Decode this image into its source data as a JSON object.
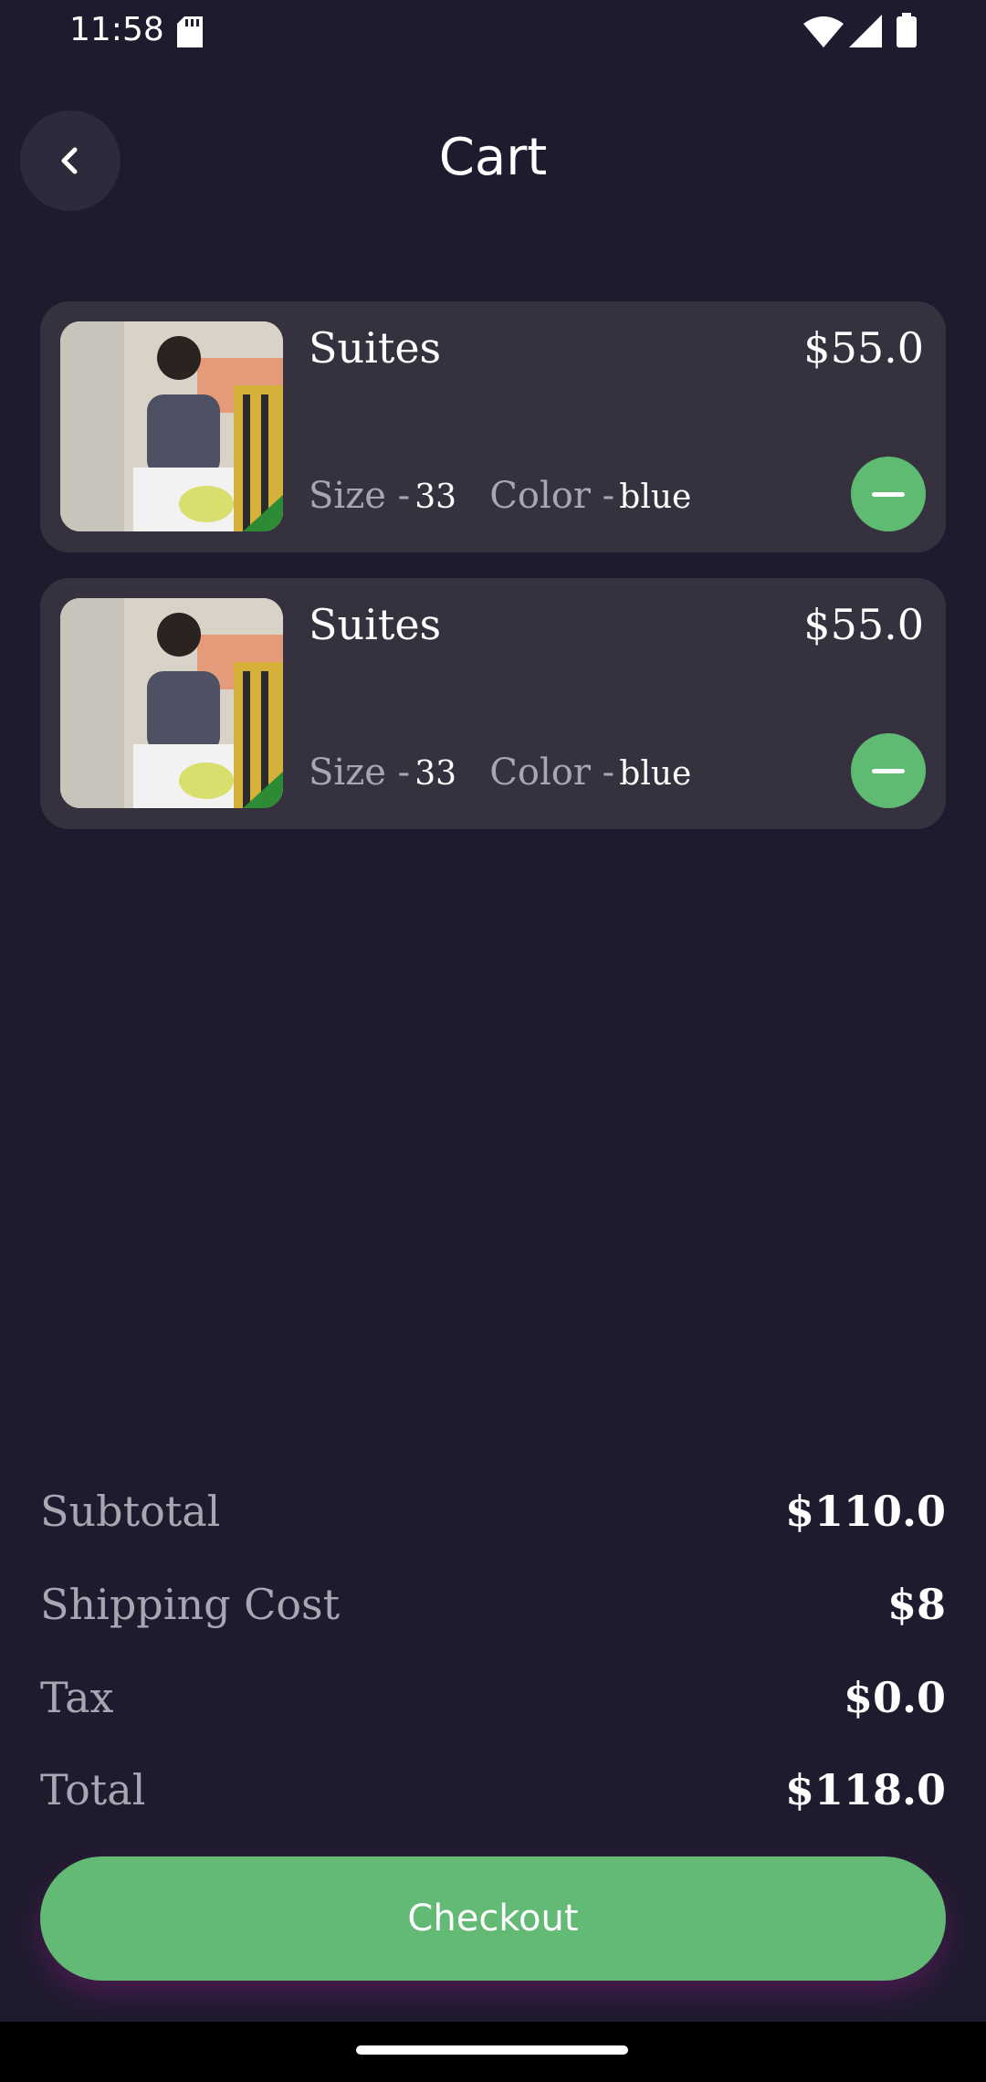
{
  "status_bar": {
    "time": "11:58"
  },
  "header": {
    "title": "Cart"
  },
  "cart_items": [
    {
      "name": "Suites",
      "price": "$55.0",
      "size_label": "Size -",
      "size_value": "33",
      "color_label": "Color -",
      "color_value": "blue"
    },
    {
      "name": "Suites",
      "price": "$55.0",
      "size_label": "Size -",
      "size_value": "33",
      "color_label": "Color -",
      "color_value": "blue"
    }
  ],
  "summary": {
    "subtotal_label": "Subtotal",
    "subtotal_value": "$110.0",
    "shipping_label": "Shipping Cost",
    "shipping_value": "$8",
    "tax_label": "Tax",
    "tax_value": "$0.0",
    "total_label": "Total",
    "total_value": "$118.0"
  },
  "checkout_label": "Checkout",
  "colors": {
    "background": "#1f1b2e",
    "card": "#35313f",
    "accent_green": "#60bb72",
    "muted_text": "#a9a6b2"
  }
}
